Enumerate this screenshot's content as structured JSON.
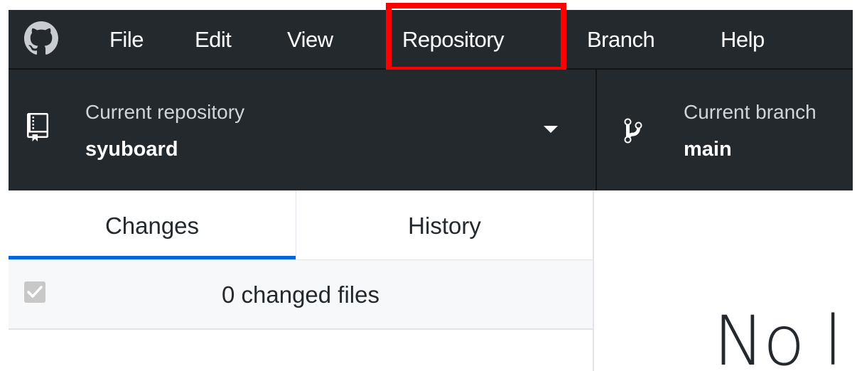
{
  "menubar": {
    "logo_icon": "github-octocat-icon",
    "items": [
      {
        "label": "File"
      },
      {
        "label": "Edit"
      },
      {
        "label": "View"
      },
      {
        "label": "Repository"
      },
      {
        "label": "Branch"
      },
      {
        "label": "Help"
      }
    ],
    "highlighted_item": "Repository",
    "highlight_color": "#ff0000"
  },
  "toolbar": {
    "repository": {
      "label": "Current repository",
      "value": "syuboard",
      "icon": "repo-icon"
    },
    "branch": {
      "label": "Current branch",
      "value": "main",
      "icon": "git-branch-icon"
    }
  },
  "sidebar": {
    "tabs": [
      {
        "label": "Changes",
        "selected": true
      },
      {
        "label": "History",
        "selected": false
      }
    ],
    "changes": {
      "label": "0 changed files",
      "checkbox_checked": true
    }
  },
  "main": {
    "blankslate_title": "No l"
  },
  "colors": {
    "chrome_bg": "#24292e",
    "accent": "#0366d6",
    "highlight": "#ff0000"
  }
}
